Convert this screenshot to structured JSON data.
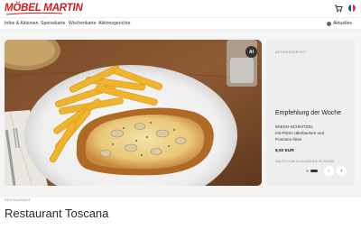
{
  "header": {
    "logo_text": "MÖBEL MARTIN",
    "brand_color": "#d41b1b",
    "cart_icon": "cart-icon",
    "language": "fr",
    "flag_colors": [
      "#1f4ea3",
      "#ffffff",
      "#e63131"
    ]
  },
  "nav": {
    "items": [
      "Infos & Aktionen",
      "Speisekarte",
      "Wochenkarte",
      "Aktionsgerichte"
    ],
    "news_label": "Aktuelles",
    "news_icon": "info-icon"
  },
  "hero": {
    "image_desc_icon": "schnitzel-photo",
    "ai_badge": "AI"
  },
  "promo": {
    "label": "AKTIONSGERICHT",
    "title": "Empfehlung der Woche",
    "dish": "WIESN-SCHNITZEL",
    "desc_line1": "mit Pilzen überbacken und",
    "desc_line2": "Pommes frites",
    "price": "8,50 EUR",
    "valid": "GÜLTIG VOM 21.09.2026 BIS 30.09.2026"
  },
  "carousel": {
    "prev_label": "‹",
    "next_label": "›"
  },
  "restaurant": {
    "label": "RESTAURANT",
    "title": "Restaurant Toscana"
  }
}
